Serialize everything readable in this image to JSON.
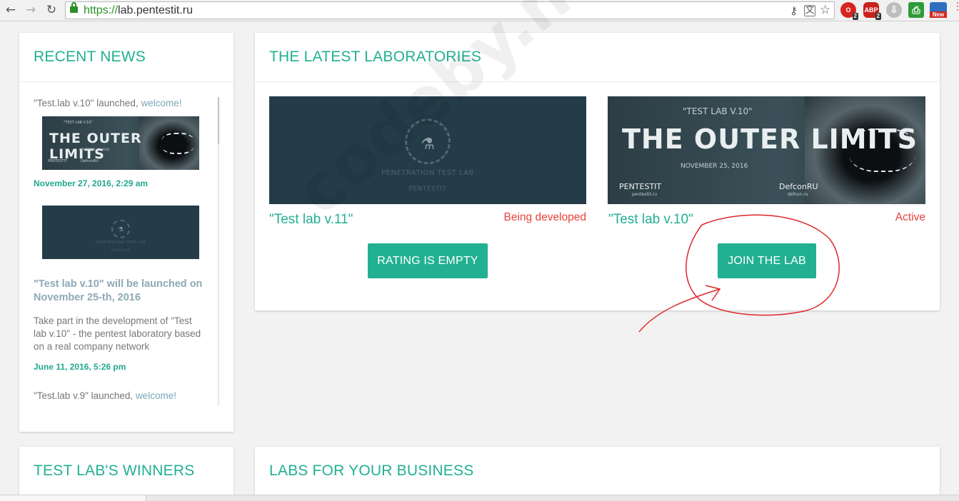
{
  "browser": {
    "url_scheme": "https://",
    "url_host": "lab.pentestit.ru",
    "back_glyph": "←",
    "forward_glyph": "→",
    "reload_glyph": "↻",
    "ext_opera_badge": "2",
    "ext_abp_label": "ABP",
    "ext_abp_badge": "2",
    "ext_new_label": "New"
  },
  "news": {
    "title": "RECENT NEWS",
    "item1_text": "\"Test.lab v.10\" launched,",
    "item1_link": "welcome!",
    "item1_date": "November 27, 2016, 2:29 am",
    "item2_heading": "\"Test lab v.10\" will be launched on November 25-th, 2016",
    "item2_text": "Take part in the development of \"Test lab v.10\" - the pentest laboratory based on a real company network",
    "item2_date": "June 11, 2016, 5:26 pm",
    "item3_text": "\"Test.lab v.9\" launched,",
    "item3_link": "welcome!"
  },
  "labs": {
    "title": "THE LATEST LABORATORIES",
    "lab11": {
      "name": "\"Test lab v.11\"",
      "status": "Being developed",
      "button": "RATING IS EMPTY",
      "banner_text": "PENETRATION TEST LAB",
      "banner_brand": "PENTESTIT"
    },
    "lab10": {
      "name": "\"Test lab v.10\"",
      "status": "Active",
      "button": "JOIN THE LAB",
      "banner_small": "\"TEST LAB V.10\"",
      "banner_title": "THE OUTER LIMITS",
      "banner_date": "NOVEMBER 25, 2016",
      "banner_brand": "PENTESTIT",
      "banner_brand_sub": "pentestit.ru",
      "banner_partner": "DefconRU",
      "banner_partner_sub": "defcon.ru"
    }
  },
  "winners": {
    "title": "TEST LAB'S WINNERS"
  },
  "business": {
    "title": "LABS FOR YOUR BUSINESS"
  },
  "watermark": "codeby.net",
  "colors": {
    "accent": "#22b092",
    "status_red": "#e8413b",
    "annotation_red": "#e0262a"
  }
}
